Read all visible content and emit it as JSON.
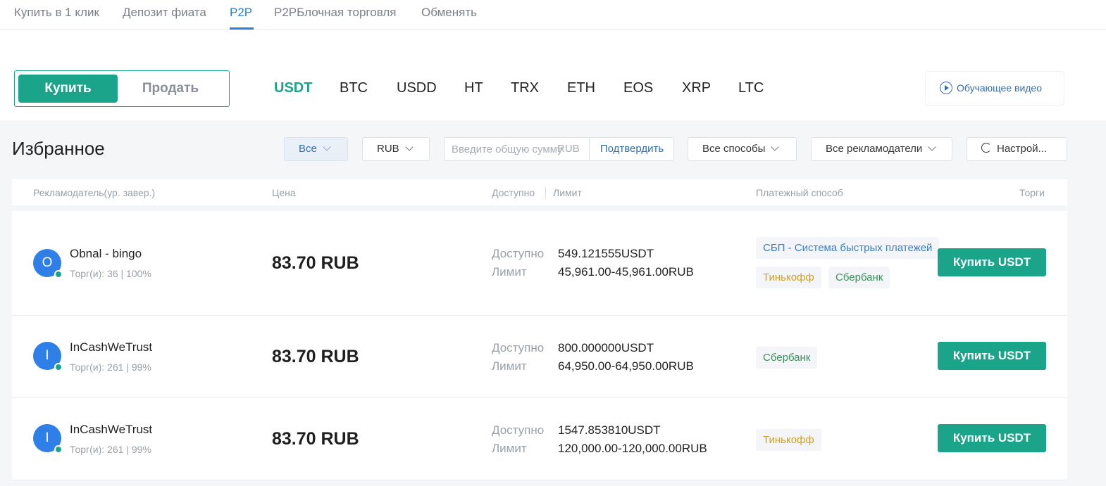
{
  "top_tabs": [
    "Купить в 1 клик",
    "Депозит фиата",
    "P2P",
    "P2PБлочная торговля",
    "Обменять"
  ],
  "trade_toggle": {
    "buy": "Купить",
    "sell": "Продать"
  },
  "coins": [
    "USDT",
    "BTC",
    "USDD",
    "HT",
    "TRX",
    "ETH",
    "EOS",
    "XRP",
    "LTC"
  ],
  "video_button": "Обучающее видео",
  "favorites_title": "Избранное",
  "filters": {
    "all": "Все",
    "currency": "RUB",
    "amount_placeholder": "Введите общую сумму",
    "amount_currency": "RUB",
    "confirm": "Подтвердить",
    "methods": "Все способы",
    "advertisers": "Все рекламодатели",
    "settings": "Настрой..."
  },
  "table_headers": {
    "advertiser": "Рекламодатель(ур. завер.)",
    "price": "Цена",
    "available": "Доступно",
    "limit": "Лимит",
    "payment": "Платежный способ",
    "trade": "Торги"
  },
  "row_labels": {
    "available": "Доступно",
    "limit": "Лимит"
  },
  "offers": [
    {
      "initial": "O",
      "name": "Obnal - bingo",
      "stats": "Торг(и): 36 | 100%",
      "price": "83.70 RUB",
      "available": "549.121555USDT",
      "limit": "45,961.00-45,961.00RUB",
      "payments": [
        "СБП - Система быстрых платежей",
        "Тинькофф",
        "Сбербанк"
      ],
      "button": "Купить USDT"
    },
    {
      "initial": "I",
      "name": "InCashWeTrust",
      "stats": "Торг(и): 261 | 99%",
      "price": "83.70 RUB",
      "available": "800.000000USDT",
      "limit": "64,950.00-64,950.00RUB",
      "payments": [
        "Сбербанк"
      ],
      "button": "Купить USDT"
    },
    {
      "initial": "I",
      "name": "InCashWeTrust",
      "stats": "Торг(и): 261 | 99%",
      "price": "83.70 RUB",
      "available": "1547.853810USDT",
      "limit": "120,000.00-120,000.00RUB",
      "payments": [
        "Тинькофф"
      ],
      "button": "Купить USDT"
    }
  ],
  "colors": {
    "accent_green": "#1aa58a",
    "link_blue": "#2f7fd6"
  }
}
